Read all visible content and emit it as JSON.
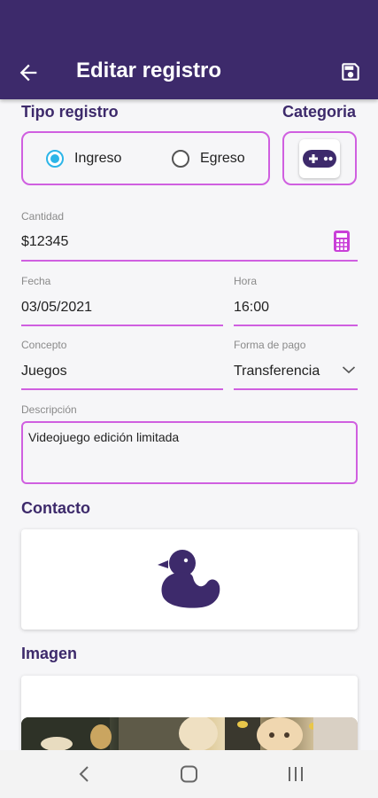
{
  "header": {
    "title": "Editar registro",
    "back_icon": "arrow-left-icon",
    "save_icon": "save-icon"
  },
  "tipo_registro": {
    "label": "Tipo registro",
    "options": [
      {
        "label": "Ingreso",
        "checked": true
      },
      {
        "label": "Egreso",
        "checked": false
      }
    ]
  },
  "categoria": {
    "label": "Categoria",
    "icon": "gamepad-icon"
  },
  "cantidad": {
    "label": "Cantidad",
    "value": "$12345",
    "icon": "calculator-icon"
  },
  "fecha": {
    "label": "Fecha",
    "value": "03/05/2021"
  },
  "hora": {
    "label": "Hora",
    "value": "16:00"
  },
  "concepto": {
    "label": "Concepto",
    "value": "Juegos"
  },
  "forma_pago": {
    "label": "Forma de pago",
    "value": "Transferencia"
  },
  "descripcion": {
    "label": "Descripción",
    "value": "Videojuego edición limitada"
  },
  "contacto": {
    "label": "Contacto",
    "icon": "duck-icon"
  },
  "imagen": {
    "label": "Imagen"
  },
  "colors": {
    "primary": "#3d2a6b",
    "accent": "#d05fe0",
    "radio": "#2cb5e8",
    "calculator": "#c93fd8"
  },
  "navbar": {
    "back_icon": "nav-back-icon",
    "home_icon": "nav-home-icon",
    "recents_icon": "nav-recents-icon"
  }
}
